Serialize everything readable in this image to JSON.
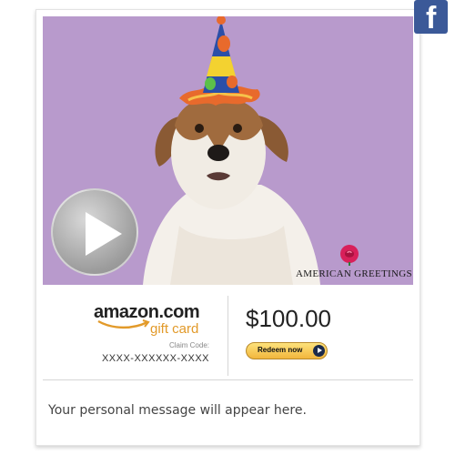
{
  "social": {
    "facebook_icon": "facebook-icon"
  },
  "video": {
    "brand": "AMERICAN GREETINGS",
    "play_icon": "play-icon",
    "background_color": "#b89acc"
  },
  "gift_card": {
    "logo_text": "amazon.com",
    "logo_subtext": "gift card",
    "claim_label": "Claim Code:",
    "claim_code": "XXXX-XXXXXX-XXXX",
    "amount": "$100.00",
    "redeem_label": "Redeem now"
  },
  "message": {
    "text": "Your personal message will appear here."
  },
  "colors": {
    "facebook": "#3b5998",
    "amazon_orange": "#e29a2a",
    "redeem_gold": "#f2b63c"
  }
}
